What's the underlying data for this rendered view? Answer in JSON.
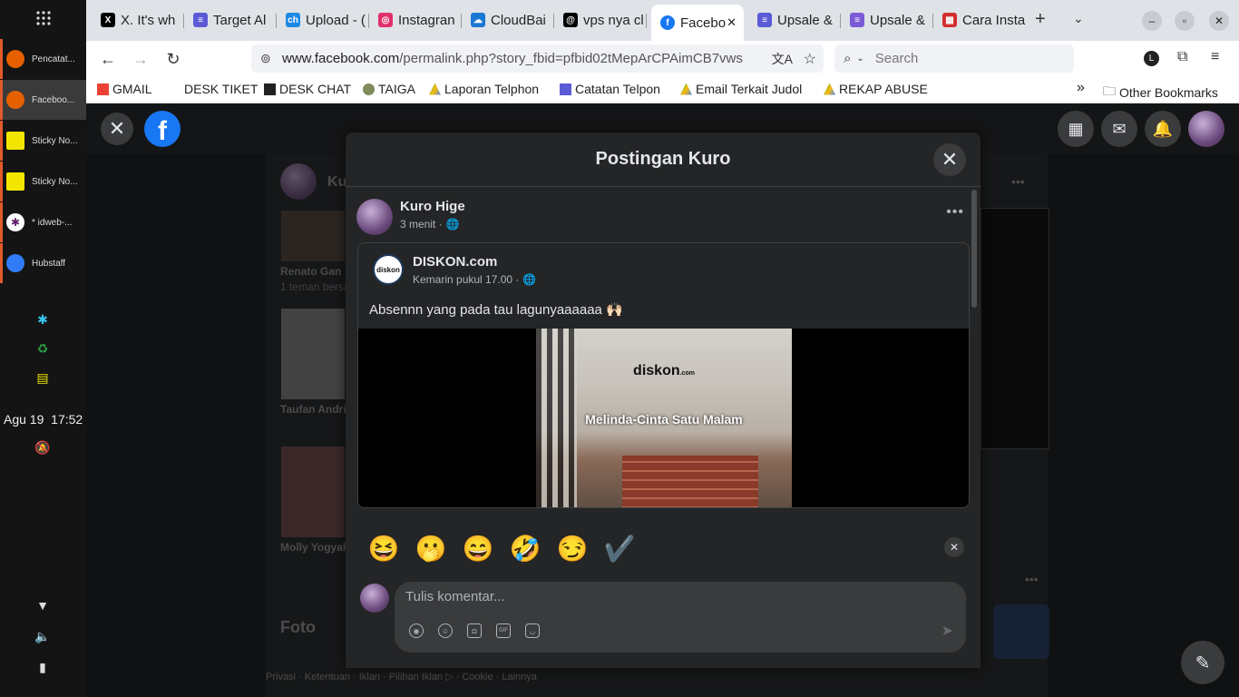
{
  "taskbar": {
    "items": [
      {
        "label": "Pencatat...",
        "icon": "firefox-icon",
        "color": "#e66000"
      },
      {
        "label": "Faceboo...",
        "icon": "firefox-icon",
        "color": "#e66000"
      },
      {
        "label": "Sticky No...",
        "icon": "sticky-notes-icon",
        "color": "#f2e600"
      },
      {
        "label": "Sticky No...",
        "icon": "sticky-notes-icon",
        "color": "#f2e600"
      },
      {
        "label": "* idweb-...",
        "icon": "slack-icon",
        "color": "#611f69"
      },
      {
        "label": "Hubstaff",
        "icon": "hubstaff-icon",
        "color": "#2f7cf6"
      }
    ],
    "date": "Agu 19",
    "time": "17:52"
  },
  "browser": {
    "tabs": [
      {
        "title": "X. It's wh",
        "fav": "X",
        "color": "#000000"
      },
      {
        "title": "Target Al",
        "fav": "≡",
        "color": "#5b5bd6"
      },
      {
        "title": "Upload - (",
        "fav": "ch",
        "color": "#1e88e5"
      },
      {
        "title": "Instagran",
        "fav": "◎",
        "color": "#e1306c"
      },
      {
        "title": "CloudBai",
        "fav": "☁",
        "color": "#1976d2"
      },
      {
        "title": "vps nya cl",
        "fav": "@",
        "color": "#000000"
      },
      {
        "title": "Facebo",
        "fav": "f",
        "color": "#1877f2"
      },
      {
        "title": "Upsale &",
        "fav": "≡",
        "color": "#5b5bd6"
      },
      {
        "title": "Upsale &",
        "fav": "≡",
        "color": "#7b5bd6"
      },
      {
        "title": "Cara Insta",
        "fav": "▦",
        "color": "#d32f2f"
      }
    ],
    "url_host": "www.facebook.com",
    "url_path": "/permalink.php?story_fbid=pfbid02tMepArCPAimCB7vws",
    "search_placeholder": "Search",
    "profile_letter": "L",
    "bookmarks": [
      {
        "label": "GMAIL",
        "color": "#ea4335"
      },
      {
        "label": "DESK TIKET",
        "color": "#ffffff"
      },
      {
        "label": "DESK CHAT",
        "color": "#222222"
      },
      {
        "label": "TAIGA",
        "color": "#7e8b5a"
      },
      {
        "label": "Laporan Telphon",
        "color": "#34a853"
      },
      {
        "label": "Catatan Telpon",
        "color": "#5b5bd6"
      },
      {
        "label": "Email Terkait Judol",
        "color": "#34a853"
      },
      {
        "label": "REKAP ABUSE",
        "color": "#34a853"
      }
    ],
    "other_bookmarks": "Other Bookmarks"
  },
  "background": {
    "friends": [
      "Renato Gan",
      "Taufan Andri",
      "Molly Yogyak"
    ],
    "friend_sub": "1 teman bersa",
    "section": "Foto",
    "footer": "Privasi · Ketentuan · Iklan · Pilihan Iklan ▷ · Cookie · Lainnya",
    "profile_name": "Ku"
  },
  "modal": {
    "title": "Postingan Kuro",
    "author": "Kuro Hige",
    "time": "3 menit ·",
    "shared_page": "DISKON.com",
    "shared_time": "Kemarin pukul 17.00 ·",
    "caption": "Absennn yang pada tau lagunyaaaaaa 🙌🏻",
    "video_logo": "diskon",
    "video_logo_sub": ".com",
    "video_title": "Melinda-Cinta Satu Malam",
    "emojis": [
      "😆",
      "🫢",
      "😄",
      "🤣",
      "😏",
      "✔️"
    ],
    "comment_placeholder": "Tulis komentar..."
  }
}
